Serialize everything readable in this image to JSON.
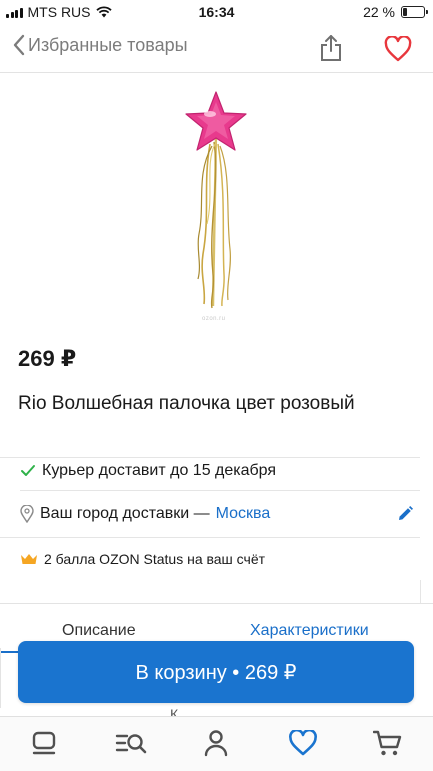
{
  "status_bar": {
    "carrier": "MTS RUS",
    "time": "16:34",
    "battery_percent": "22 %",
    "battery_level": 0.22
  },
  "nav": {
    "back_label": "Избранные товары",
    "share_icon": "share-icon",
    "favorite_icon": "heart-icon",
    "accent_color": "#e8373d"
  },
  "product": {
    "image_watermark": "ozon.ru",
    "price": "269 ₽",
    "title": "Rio Волшебная палочка цвет розовый"
  },
  "delivery": {
    "courier_text": "Курьер доставит до 15 декабря",
    "city_prefix": "Ваш город доставки —",
    "city": "Москва",
    "status_text": "2 балла OZON Status на ваш счёт"
  },
  "tabs": [
    {
      "label": "Описание"
    },
    {
      "label": "Характеристики"
    }
  ],
  "cart_button": {
    "label": "В корзину • 269 ₽",
    "color": "#1a74cf"
  },
  "peek_text": "К",
  "tab_bar": [
    {
      "icon": "home-icon"
    },
    {
      "icon": "catalog-search-icon"
    },
    {
      "icon": "profile-icon"
    },
    {
      "icon": "favorites-heart-icon",
      "active": true
    },
    {
      "icon": "cart-icon"
    }
  ],
  "colors": {
    "link_blue": "#1a6fc9",
    "check_green": "#2fb24a",
    "status_crown": "#f5a623"
  }
}
